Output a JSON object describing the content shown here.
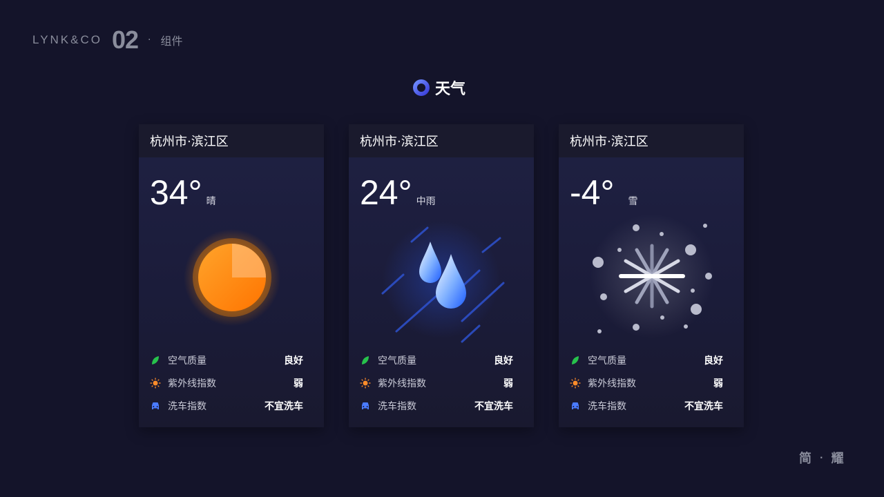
{
  "brand": {
    "logo": "LYNK&CO",
    "number": "02",
    "separator": "·",
    "subtitle": "组件"
  },
  "section": {
    "icon": "ring-logo-icon",
    "title": "天气"
  },
  "colors": {
    "background": "#14142a",
    "sun": "#ff8a00",
    "rain": "#3a7cff",
    "snow": "#ffffff",
    "leaf": "#27c24c",
    "uv": "#ff8c2a",
    "car": "#4a7bff"
  },
  "cards": [
    {
      "location": "杭州市·滨江区",
      "temperature": "34°",
      "condition": "晴",
      "illustration": "sun-icon",
      "stats": [
        {
          "icon": "leaf-icon",
          "label": "空气质量",
          "value": "良好"
        },
        {
          "icon": "sun-small-icon",
          "label": "紫外线指数",
          "value": "弱"
        },
        {
          "icon": "car-icon",
          "label": "洗车指数",
          "value": "不宜洗车"
        }
      ]
    },
    {
      "location": "杭州市·滨江区",
      "temperature": "24°",
      "condition": "中雨",
      "illustration": "raindrops-icon",
      "stats": [
        {
          "icon": "leaf-icon",
          "label": "空气质量",
          "value": "良好"
        },
        {
          "icon": "sun-small-icon",
          "label": "紫外线指数",
          "value": "弱"
        },
        {
          "icon": "car-icon",
          "label": "洗车指数",
          "value": "不宜洗车"
        }
      ]
    },
    {
      "location": "杭州市·滨江区",
      "temperature": "-4°",
      "condition": "雪",
      "illustration": "snowflake-icon",
      "stats": [
        {
          "icon": "leaf-icon",
          "label": "空气质量",
          "value": "良好"
        },
        {
          "icon": "sun-small-icon",
          "label": "紫外线指数",
          "value": "弱"
        },
        {
          "icon": "car-icon",
          "label": "洗车指数",
          "value": "不宜洗车"
        }
      ]
    }
  ],
  "footer": {
    "left": "简",
    "separator": "·",
    "right": "耀"
  }
}
